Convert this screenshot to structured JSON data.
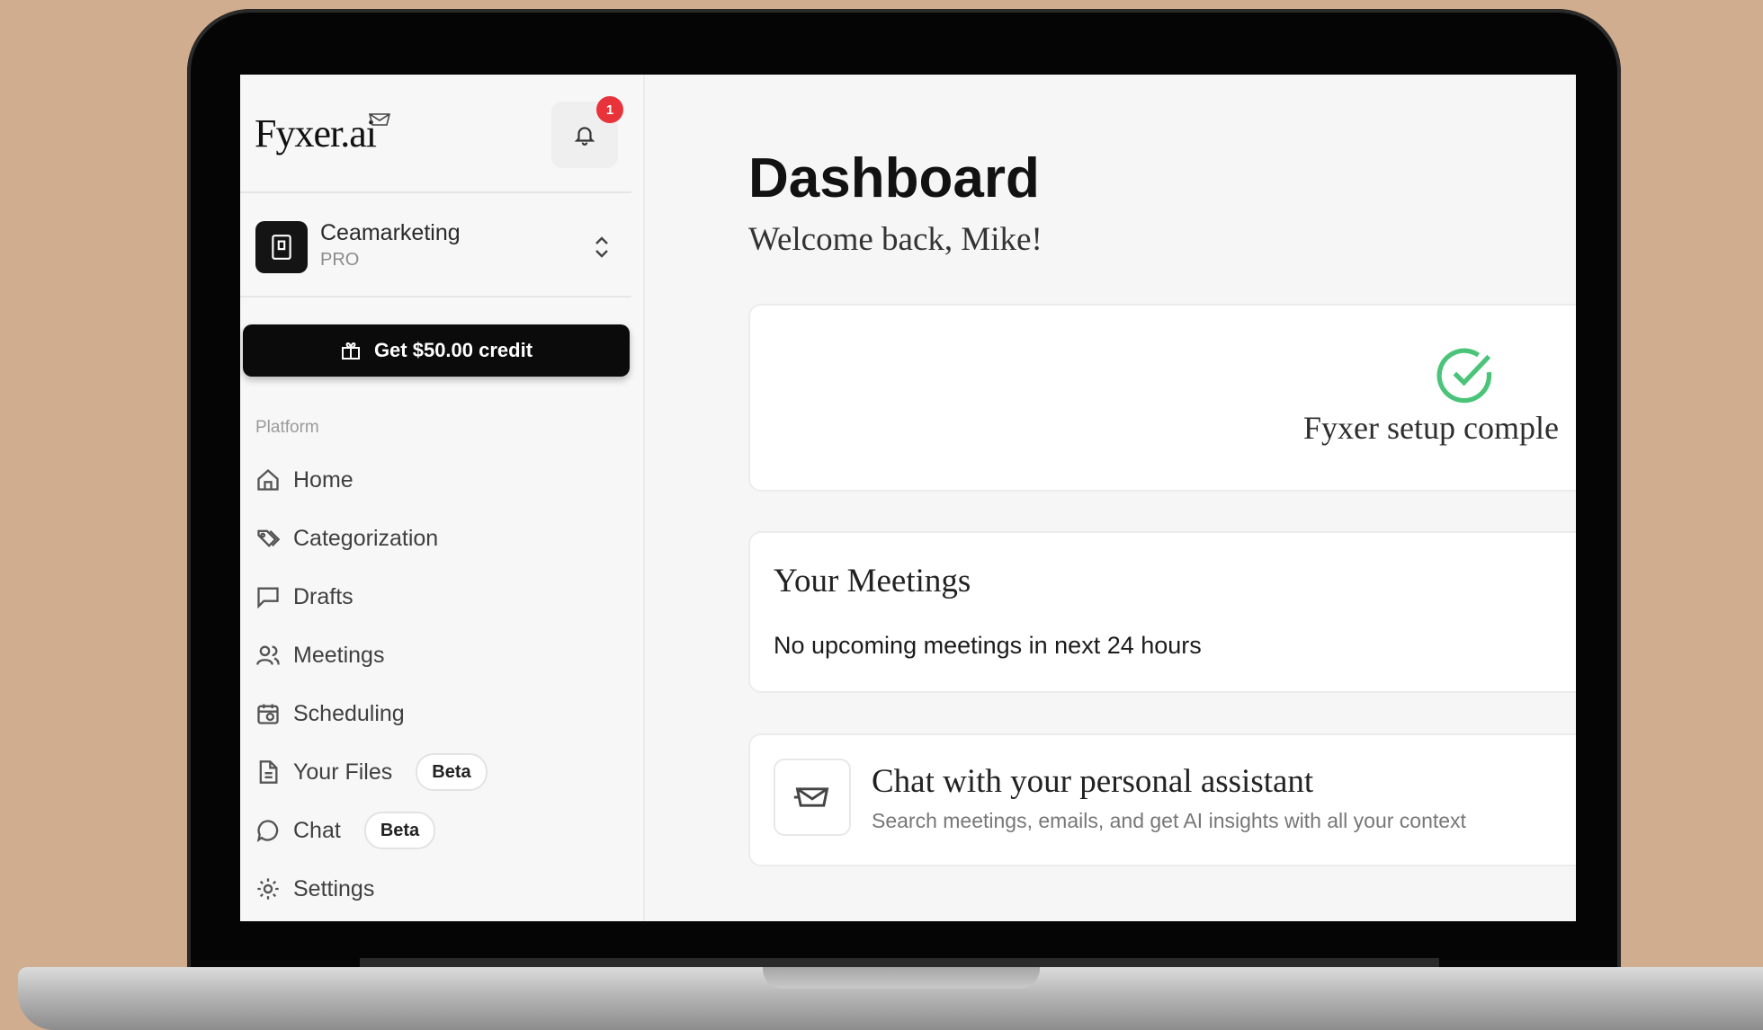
{
  "sidebar": {
    "logo_text": "Fyxer.ai",
    "notification_count": "1",
    "org": {
      "name": "Ceamarketing",
      "plan": "PRO"
    },
    "credit_button": "Get $50.00 credit",
    "section_label": "Platform",
    "items": [
      {
        "label": "Home",
        "icon": "home-icon"
      },
      {
        "label": "Categorization",
        "icon": "tags-icon"
      },
      {
        "label": "Drafts",
        "icon": "message-square-icon"
      },
      {
        "label": "Meetings",
        "icon": "users-icon"
      },
      {
        "label": "Scheduling",
        "icon": "calendar-clock-icon"
      },
      {
        "label": "Your Files",
        "icon": "file-icon",
        "badge": "Beta"
      },
      {
        "label": "Chat",
        "icon": "chat-bubble-icon",
        "badge": "Beta"
      },
      {
        "label": "Settings",
        "icon": "gear-icon"
      }
    ]
  },
  "main": {
    "title": "Dashboard",
    "welcome": "Welcome back, Mike!",
    "setup_card": {
      "text": "Fyxer setup comple",
      "icon": "check-circle-icon",
      "color": "#4bc47a"
    },
    "meetings_card": {
      "title": "Your Meetings",
      "empty_text": "No upcoming meetings in next 24 hours"
    },
    "chat_card": {
      "title": "Chat with your personal assistant",
      "subtitle": "Search meetings, emails, and get AI insights with all your context",
      "icon": "envelope-icon"
    }
  },
  "colors": {
    "background": "#d0ad8f",
    "accent_dark": "#0b0b0b",
    "badge_red": "#e8333a"
  }
}
